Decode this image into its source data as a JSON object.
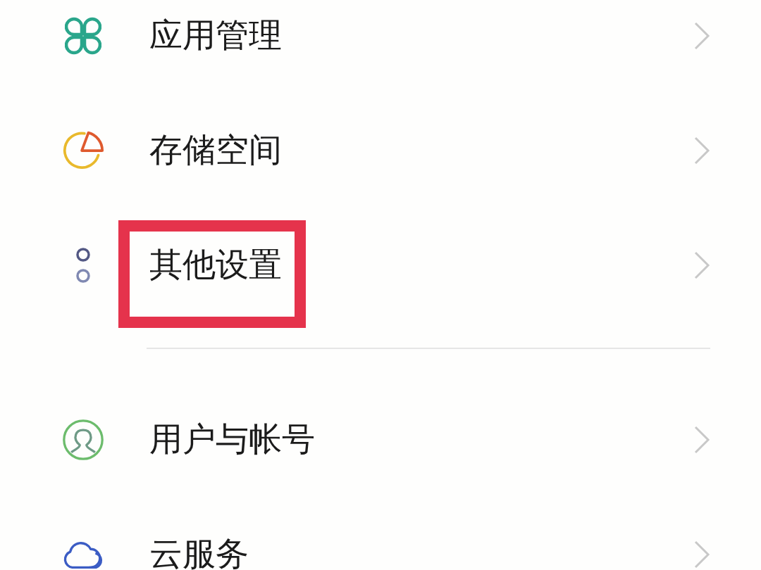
{
  "groups": [
    {
      "items": [
        {
          "label": "应用管理",
          "highlighted": false
        },
        {
          "label": "存储空间",
          "highlighted": false
        },
        {
          "label": "其他设置",
          "highlighted": true
        }
      ]
    },
    {
      "items": [
        {
          "label": "用户与帐号",
          "highlighted": false
        },
        {
          "label": "云服务",
          "highlighted": false
        }
      ]
    }
  ]
}
